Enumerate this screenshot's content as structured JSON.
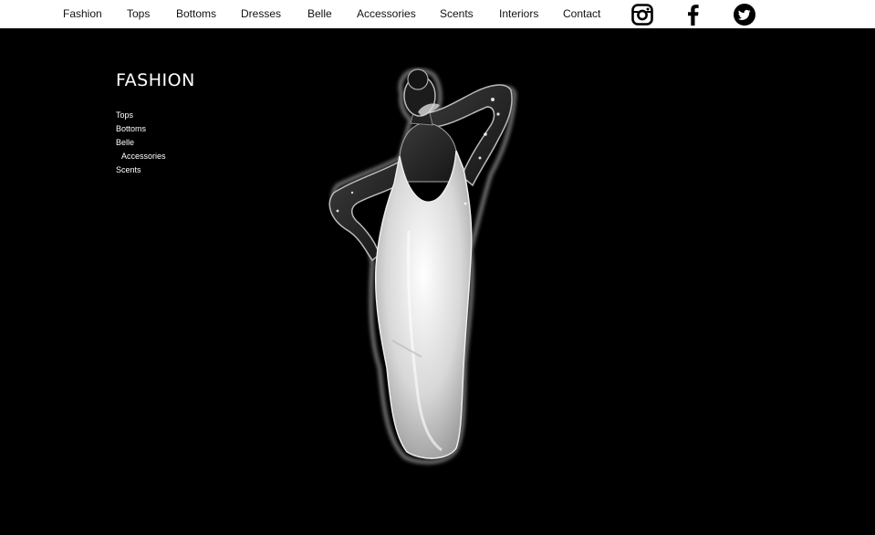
{
  "nav": {
    "items": [
      "Fashion",
      "Tops",
      "Bottoms",
      "Dresses",
      "Belle",
      "Accessories",
      "Scents",
      "Interiors",
      "Contact"
    ]
  },
  "social": {
    "icons": [
      "instagram-icon",
      "facebook-icon",
      "twitter-icon"
    ]
  },
  "sidebar": {
    "title": "FASHION",
    "links": [
      {
        "label": "Tops",
        "sub": false
      },
      {
        "label": "Bottoms",
        "sub": false
      },
      {
        "label": "Belle",
        "sub": false
      },
      {
        "label": "Accessories",
        "sub": true
      },
      {
        "label": "Scents",
        "sub": false
      }
    ]
  },
  "colors": {
    "background": "#000000",
    "topbar": "#ffffff",
    "text_dark": "#111111",
    "text_light": "#ffffff"
  }
}
